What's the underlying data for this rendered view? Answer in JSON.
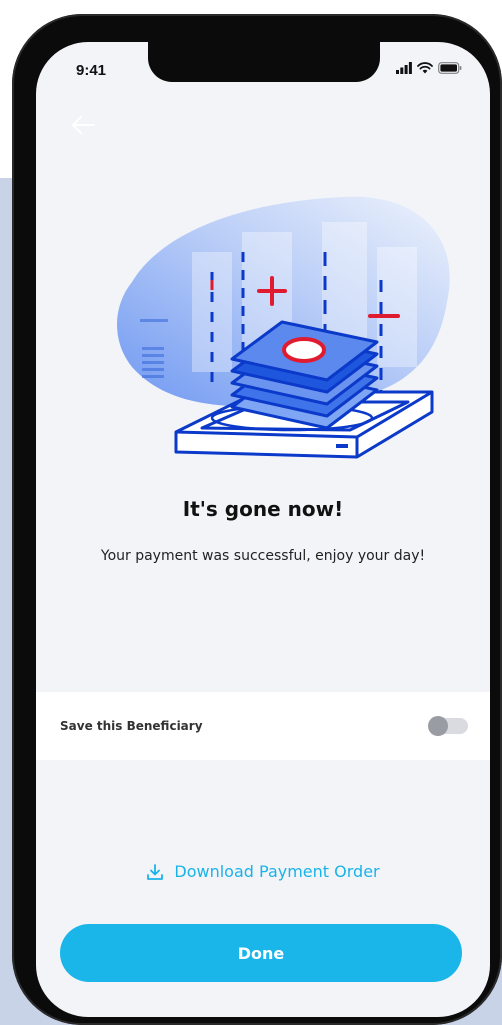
{
  "status_bar": {
    "time": "9:41",
    "icons": [
      "signal-icon",
      "wifi-icon",
      "battery-icon"
    ]
  },
  "nav": {
    "back_icon": "back-arrow-icon"
  },
  "illustration": {
    "icon": "payment-success-illustration",
    "colors": {
      "primary_blue": "#0b39c9",
      "accent_red": "#e01b2f",
      "blob_light": "#dbe6fb",
      "blob_mid": "#7fa6f4"
    }
  },
  "message": {
    "title": "It's gone now!",
    "subtitle": "Your payment was successful, enjoy your day!"
  },
  "save_beneficiary": {
    "label": "Save this Beneficiary",
    "enabled": false
  },
  "download": {
    "label": "Download Payment Order",
    "icon": "download-icon",
    "color": "#1ab3e8"
  },
  "primary_action": {
    "label": "Done",
    "color": "#1ab6ea"
  }
}
